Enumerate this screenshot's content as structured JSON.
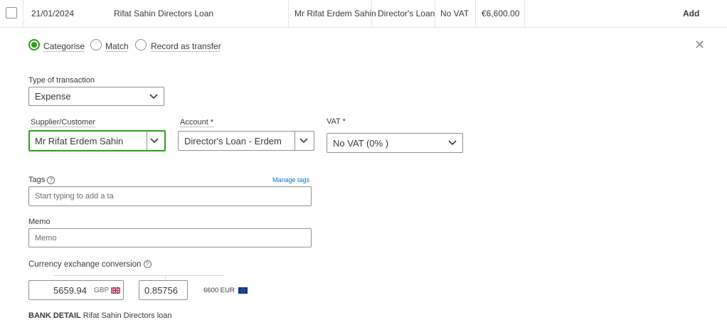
{
  "row": {
    "date": "21/01/2024",
    "description": "Rifat Sahin Directors Loan",
    "payee": "Mr Rifat Erdem Sahin",
    "category": "Director's Loan",
    "vat": "No VAT",
    "amount": "€6,600.00",
    "action": "Add"
  },
  "mode_options": [
    {
      "label": "Categorise",
      "selected": true
    },
    {
      "label": "Match",
      "selected": false
    },
    {
      "label": "Record as transfer",
      "selected": false
    }
  ],
  "form": {
    "type_label": "Type of transaction",
    "type_value": "Expense",
    "supplier_label": "Supplier/Customer",
    "supplier_value": "Mr Rifat Erdem Sahin",
    "account_label": "Account *",
    "account_value": "Director's Loan - Erdem",
    "vat_label": "VAT *",
    "vat_value": "No VAT (0% )",
    "tags_label": "Tags",
    "manage_tags": "Manage tags",
    "tags_placeholder": "Start typing to add a ta",
    "memo_label": "Memo",
    "memo_placeholder": "Memo",
    "currency_label": "Currency exchange conversion",
    "gbp_amount": "5659.94",
    "gbp_code": "GBP",
    "rate": "0.85756",
    "eur_amount": "6600 EUR",
    "bank_detail_label": "BANK DETAIL",
    "bank_detail_value": "Rifat Sahin Directors loan"
  },
  "colors": {
    "accent": "#2ca01c",
    "link": "#0077c5"
  }
}
